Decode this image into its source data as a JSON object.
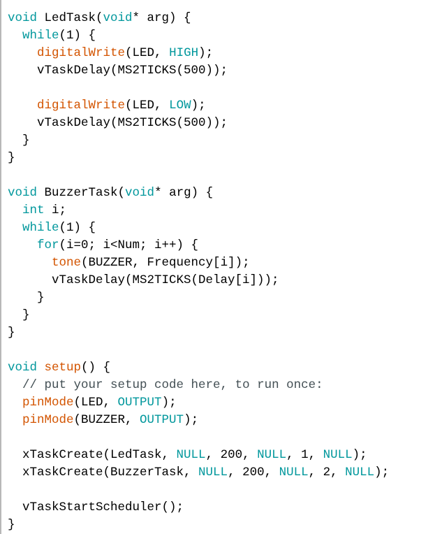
{
  "editor": {
    "language": "arduino-c",
    "colors": {
      "keyword": "#00979c",
      "function": "#d35400",
      "plain": "#000000",
      "comment": "#434f54"
    },
    "lines": [
      [
        {
          "t": "kw",
          "v": "void"
        },
        {
          "t": "plain",
          "v": " LedTask("
        },
        {
          "t": "kw",
          "v": "void"
        },
        {
          "t": "plain",
          "v": "* arg) {"
        }
      ],
      [
        {
          "t": "plain",
          "v": "  "
        },
        {
          "t": "kw",
          "v": "while"
        },
        {
          "t": "plain",
          "v": "(1) {"
        }
      ],
      [
        {
          "t": "plain",
          "v": "    "
        },
        {
          "t": "fn",
          "v": "digitalWrite"
        },
        {
          "t": "plain",
          "v": "(LED, "
        },
        {
          "t": "kw",
          "v": "HIGH"
        },
        {
          "t": "plain",
          "v": ");"
        }
      ],
      [
        {
          "t": "plain",
          "v": "    vTaskDelay(MS2TICKS(500));"
        }
      ],
      [],
      [
        {
          "t": "plain",
          "v": "    "
        },
        {
          "t": "fn",
          "v": "digitalWrite"
        },
        {
          "t": "plain",
          "v": "(LED, "
        },
        {
          "t": "kw",
          "v": "LOW"
        },
        {
          "t": "plain",
          "v": ");"
        }
      ],
      [
        {
          "t": "plain",
          "v": "    vTaskDelay(MS2TICKS(500));"
        }
      ],
      [
        {
          "t": "plain",
          "v": "  }"
        }
      ],
      [
        {
          "t": "plain",
          "v": "}"
        }
      ],
      [],
      [
        {
          "t": "kw",
          "v": "void"
        },
        {
          "t": "plain",
          "v": " BuzzerTask("
        },
        {
          "t": "kw",
          "v": "void"
        },
        {
          "t": "plain",
          "v": "* arg) {"
        }
      ],
      [
        {
          "t": "plain",
          "v": "  "
        },
        {
          "t": "kw",
          "v": "int"
        },
        {
          "t": "plain",
          "v": " i;"
        }
      ],
      [
        {
          "t": "plain",
          "v": "  "
        },
        {
          "t": "kw",
          "v": "while"
        },
        {
          "t": "plain",
          "v": "(1) {"
        }
      ],
      [
        {
          "t": "plain",
          "v": "    "
        },
        {
          "t": "kw",
          "v": "for"
        },
        {
          "t": "plain",
          "v": "(i=0; i<Num; i++) {"
        }
      ],
      [
        {
          "t": "plain",
          "v": "      "
        },
        {
          "t": "fn",
          "v": "tone"
        },
        {
          "t": "plain",
          "v": "(BUZZER, Frequency[i]);"
        }
      ],
      [
        {
          "t": "plain",
          "v": "      vTaskDelay(MS2TICKS(Delay[i]));"
        }
      ],
      [
        {
          "t": "plain",
          "v": "    }"
        }
      ],
      [
        {
          "t": "plain",
          "v": "  }"
        }
      ],
      [
        {
          "t": "plain",
          "v": "}"
        }
      ],
      [],
      [
        {
          "t": "kw",
          "v": "void"
        },
        {
          "t": "plain",
          "v": " "
        },
        {
          "t": "fn",
          "v": "setup"
        },
        {
          "t": "plain",
          "v": "() {"
        }
      ],
      [
        {
          "t": "plain",
          "v": "  "
        },
        {
          "t": "comment",
          "v": "// put your setup code here, to run once:"
        }
      ],
      [
        {
          "t": "plain",
          "v": "  "
        },
        {
          "t": "fn",
          "v": "pinMode"
        },
        {
          "t": "plain",
          "v": "(LED, "
        },
        {
          "t": "kw",
          "v": "OUTPUT"
        },
        {
          "t": "plain",
          "v": ");"
        }
      ],
      [
        {
          "t": "plain",
          "v": "  "
        },
        {
          "t": "fn",
          "v": "pinMode"
        },
        {
          "t": "plain",
          "v": "(BUZZER, "
        },
        {
          "t": "kw",
          "v": "OUTPUT"
        },
        {
          "t": "plain",
          "v": ");"
        }
      ],
      [],
      [
        {
          "t": "plain",
          "v": "  xTaskCreate(LedTask, "
        },
        {
          "t": "kw",
          "v": "NULL"
        },
        {
          "t": "plain",
          "v": ", 200, "
        },
        {
          "t": "kw",
          "v": "NULL"
        },
        {
          "t": "plain",
          "v": ", 1, "
        },
        {
          "t": "kw",
          "v": "NULL"
        },
        {
          "t": "plain",
          "v": ");"
        }
      ],
      [
        {
          "t": "plain",
          "v": "  xTaskCreate(BuzzerTask, "
        },
        {
          "t": "kw",
          "v": "NULL"
        },
        {
          "t": "plain",
          "v": ", 200, "
        },
        {
          "t": "kw",
          "v": "NULL"
        },
        {
          "t": "plain",
          "v": ", 2, "
        },
        {
          "t": "kw",
          "v": "NULL"
        },
        {
          "t": "plain",
          "v": ");"
        }
      ],
      [],
      [
        {
          "t": "plain",
          "v": "  vTaskStartScheduler();"
        }
      ],
      [
        {
          "t": "plain",
          "v": "}"
        }
      ]
    ]
  }
}
